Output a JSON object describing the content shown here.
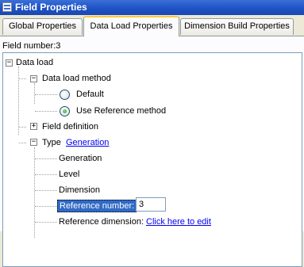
{
  "window": {
    "title": "Field Properties"
  },
  "tabs": [
    {
      "label": "Global Properties"
    },
    {
      "label": "Data Load Properties",
      "active": true
    },
    {
      "label": "Dimension Build Properties"
    }
  ],
  "field_number_label": "Field number:3",
  "tree": {
    "data_load": "Data load",
    "data_load_method": "Data load method",
    "option_default": "Default",
    "option_use_reference": "Use Reference method",
    "selected_method": "Use Reference method",
    "field_definition": "Field definition",
    "type_label": "Type",
    "type_value": "Generation",
    "type_generation": "Generation",
    "type_level": "Level",
    "type_dimension": "Dimension",
    "reference_number_label": "Reference number:",
    "reference_number_value": "3",
    "reference_dimension_label": "Reference dimension:",
    "reference_dimension_link": "Click here to edit"
  },
  "icons": {
    "window": "window-icon",
    "collapse": "minus-box-icon",
    "expand": "plus-box-icon",
    "radio": "radio-button-icon"
  },
  "colors": {
    "titlebar": "#1f52c4",
    "selection": "#316ac5",
    "link": "#0000ee",
    "active_tab_accent": "#ffc83c"
  }
}
